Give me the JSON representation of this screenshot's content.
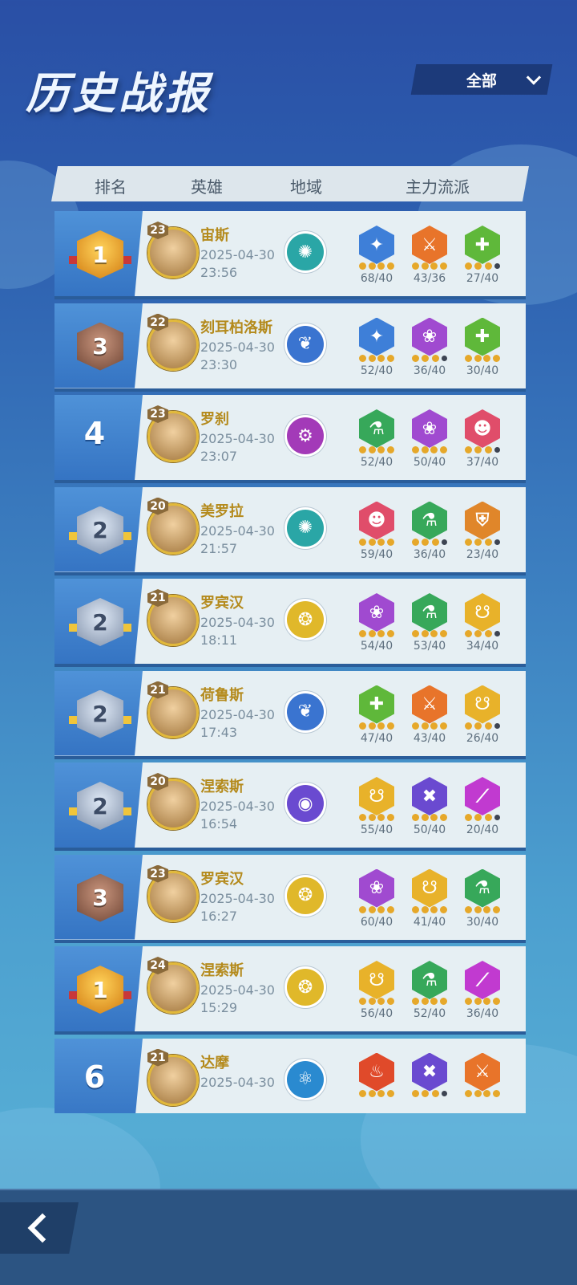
{
  "page": {
    "title": "历史战报"
  },
  "filter": {
    "label": "全部"
  },
  "columns": [
    "排名",
    "英雄",
    "地域",
    "主力流派"
  ],
  "back": {
    "icon": "back-arrow-icon"
  },
  "rows": [
    {
      "rank": "1",
      "rank_style": "gold",
      "level": "23",
      "hero": "宙斯",
      "date": "2025-04-30",
      "time": "23:56",
      "region_color": "#2aa6a6",
      "region_glyph": "✺",
      "traits": [
        {
          "color": "#3e7fd8",
          "glyph": "✦",
          "value": "68/40",
          "dots": [
            1,
            1,
            1,
            1
          ]
        },
        {
          "color": "#e8742a",
          "glyph": "⚔",
          "value": "43/36",
          "dots": [
            1,
            1,
            1,
            1
          ]
        },
        {
          "color": "#5fb83a",
          "glyph": "✚",
          "value": "27/40",
          "dots": [
            1,
            1,
            1,
            0
          ]
        }
      ]
    },
    {
      "rank": "3",
      "rank_style": "bronze",
      "level": "22",
      "hero": "刻耳柏洛斯",
      "date": "2025-04-30",
      "time": "23:30",
      "region_color": "#3a74d0",
      "region_glyph": "❦",
      "traits": [
        {
          "color": "#3e7fd8",
          "glyph": "✦",
          "value": "52/40",
          "dots": [
            1,
            1,
            1,
            1
          ]
        },
        {
          "color": "#a04ad0",
          "glyph": "❀",
          "value": "36/40",
          "dots": [
            1,
            1,
            1,
            0
          ]
        },
        {
          "color": "#5fb83a",
          "glyph": "✚",
          "value": "30/40",
          "dots": [
            1,
            1,
            1,
            1
          ]
        }
      ]
    },
    {
      "rank": "4",
      "rank_style": "plain",
      "level": "23",
      "hero": "罗刹",
      "date": "2025-04-30",
      "time": "23:07",
      "region_color": "#a33ab8",
      "region_glyph": "⚙",
      "traits": [
        {
          "color": "#37a85a",
          "glyph": "⚗",
          "value": "52/40",
          "dots": [
            1,
            1,
            1,
            1
          ]
        },
        {
          "color": "#a04ad0",
          "glyph": "❀",
          "value": "50/40",
          "dots": [
            1,
            1,
            1,
            1
          ]
        },
        {
          "color": "#e04d6a",
          "glyph": "☻",
          "value": "37/40",
          "dots": [
            1,
            1,
            1,
            0
          ]
        }
      ]
    },
    {
      "rank": "2",
      "rank_style": "silver",
      "level": "20",
      "hero": "美罗拉",
      "date": "2025-04-30",
      "time": "21:57",
      "region_color": "#2aa6a6",
      "region_glyph": "✺",
      "traits": [
        {
          "color": "#e04d6a",
          "glyph": "☻",
          "value": "59/40",
          "dots": [
            1,
            1,
            1,
            1
          ]
        },
        {
          "color": "#37a85a",
          "glyph": "⚗",
          "value": "36/40",
          "dots": [
            1,
            1,
            1,
            0
          ]
        },
        {
          "color": "#e0862a",
          "glyph": "⛨",
          "value": "23/40",
          "dots": [
            1,
            1,
            1,
            0
          ]
        }
      ]
    },
    {
      "rank": "2",
      "rank_style": "silver",
      "level": "21",
      "hero": "罗宾汉",
      "date": "2025-04-30",
      "time": "18:11",
      "region_color": "#e0b82a",
      "region_glyph": "❂",
      "traits": [
        {
          "color": "#a04ad0",
          "glyph": "❀",
          "value": "54/40",
          "dots": [
            1,
            1,
            1,
            1
          ]
        },
        {
          "color": "#37a85a",
          "glyph": "⚗",
          "value": "53/40",
          "dots": [
            1,
            1,
            1,
            1
          ]
        },
        {
          "color": "#e8b22a",
          "glyph": "☋",
          "value": "34/40",
          "dots": [
            1,
            1,
            1,
            0
          ]
        }
      ]
    },
    {
      "rank": "2",
      "rank_style": "silver",
      "level": "21",
      "hero": "荷鲁斯",
      "date": "2025-04-30",
      "time": "17:43",
      "region_color": "#3a74d0",
      "region_glyph": "❦",
      "traits": [
        {
          "color": "#5fb83a",
          "glyph": "✚",
          "value": "47/40",
          "dots": [
            1,
            1,
            1,
            1
          ]
        },
        {
          "color": "#e8742a",
          "glyph": "⚔",
          "value": "43/40",
          "dots": [
            1,
            1,
            1,
            1
          ]
        },
        {
          "color": "#e8b22a",
          "glyph": "☋",
          "value": "26/40",
          "dots": [
            1,
            1,
            1,
            0
          ]
        }
      ]
    },
    {
      "rank": "2",
      "rank_style": "silver",
      "level": "20",
      "hero": "涅索斯",
      "date": "2025-04-30",
      "time": "16:54",
      "region_color": "#6a4ad0",
      "region_glyph": "◉",
      "traits": [
        {
          "color": "#e8b22a",
          "glyph": "☋",
          "value": "55/40",
          "dots": [
            1,
            1,
            1,
            1
          ]
        },
        {
          "color": "#6a4ad0",
          "glyph": "✖",
          "value": "50/40",
          "dots": [
            1,
            1,
            1,
            1
          ]
        },
        {
          "color": "#c13ad0",
          "glyph": "⟋",
          "value": "20/40",
          "dots": [
            1,
            1,
            1,
            0
          ]
        }
      ]
    },
    {
      "rank": "3",
      "rank_style": "bronze",
      "level": "23",
      "hero": "罗宾汉",
      "date": "2025-04-30",
      "time": "16:27",
      "region_color": "#e0b82a",
      "region_glyph": "❂",
      "traits": [
        {
          "color": "#a04ad0",
          "glyph": "❀",
          "value": "60/40",
          "dots": [
            1,
            1,
            1,
            1
          ]
        },
        {
          "color": "#e8b22a",
          "glyph": "☋",
          "value": "41/40",
          "dots": [
            1,
            1,
            1,
            1
          ]
        },
        {
          "color": "#37a85a",
          "glyph": "⚗",
          "value": "30/40",
          "dots": [
            1,
            1,
            1,
            1
          ]
        }
      ]
    },
    {
      "rank": "1",
      "rank_style": "gold",
      "level": "24",
      "hero": "涅索斯",
      "date": "2025-04-30",
      "time": "15:29",
      "region_color": "#e0b82a",
      "region_glyph": "❂",
      "traits": [
        {
          "color": "#e8b22a",
          "glyph": "☋",
          "value": "56/40",
          "dots": [
            1,
            1,
            1,
            1
          ]
        },
        {
          "color": "#37a85a",
          "glyph": "⚗",
          "value": "52/40",
          "dots": [
            1,
            1,
            1,
            1
          ]
        },
        {
          "color": "#c13ad0",
          "glyph": "⟋",
          "value": "36/40",
          "dots": [
            1,
            1,
            1,
            1
          ]
        }
      ]
    },
    {
      "rank": "6",
      "rank_style": "plain",
      "level": "21",
      "hero": "达摩",
      "date": "2025-04-30",
      "time": "",
      "region_color": "#2a8ad0",
      "region_glyph": "⚛",
      "traits": [
        {
          "color": "#e04a2a",
          "glyph": "♨",
          "value": "",
          "dots": [
            1,
            1,
            1,
            1
          ]
        },
        {
          "color": "#6a4ad0",
          "glyph": "✖",
          "value": "",
          "dots": [
            1,
            1,
            1,
            0
          ]
        },
        {
          "color": "#e8742a",
          "glyph": "⚔",
          "value": "",
          "dots": [
            1,
            1,
            1,
            1
          ]
        }
      ]
    }
  ]
}
